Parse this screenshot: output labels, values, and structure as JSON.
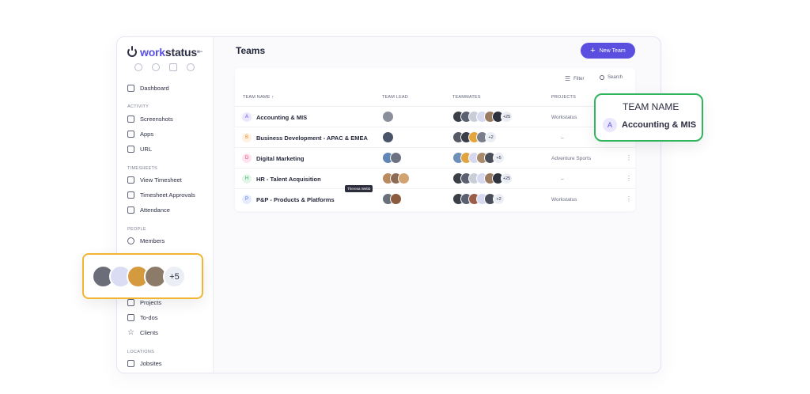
{
  "brand": {
    "logo_part1": "work",
    "logo_part2": "status"
  },
  "sidebar": {
    "items": [
      {
        "label": "Dashboard"
      },
      {
        "label": "Screenshots"
      },
      {
        "label": "Apps"
      },
      {
        "label": "URL"
      },
      {
        "label": "View Timesheet"
      },
      {
        "label": "Timesheet Approvals"
      },
      {
        "label": "Attendance"
      },
      {
        "label": "Members"
      },
      {
        "label": "Projects"
      },
      {
        "label": "To-dos"
      },
      {
        "label": "Clients"
      },
      {
        "label": "Jobsites"
      }
    ],
    "sections": [
      "ACTIVITY",
      "TIMESHEETS",
      "PEOPLE",
      "LOCATIONS"
    ]
  },
  "header": {
    "title": "Teams",
    "new_team_label": "New Team",
    "new_team_icon": "+"
  },
  "toolbar": {
    "filter_label": "Filter",
    "search_label": "Search"
  },
  "table": {
    "columns": [
      "TEAM NAME ↑",
      "TEAM LEAD",
      "TEAMMATES",
      "PROJECTS"
    ],
    "rows": [
      {
        "badge": "A",
        "name": "Accounting & MIS",
        "more": "+25",
        "project": "Workstatus"
      },
      {
        "badge": "B",
        "name": "Business Development - APAC & EMEA",
        "more": "+2",
        "project": "–"
      },
      {
        "badge": "D",
        "name": "Digital Marketing",
        "more": "+5",
        "project": "Adventure Sports"
      },
      {
        "badge": "H",
        "name": "HR - Talent Acquisition",
        "more": "+25",
        "project": "–"
      },
      {
        "badge": "P",
        "name": "P&P - Products & Platforms",
        "more": "+2",
        "project": "Workstatus"
      }
    ]
  },
  "tooltip": "Theresa Webb",
  "callout_team": {
    "title": "TEAM NAME",
    "badge": "A",
    "name": "Accounting & MIS"
  },
  "callout_avatars": {
    "more": "+5"
  },
  "colors": {
    "accent": "#5b4fe0",
    "green_callout": "#32b45f",
    "yellow_callout": "#f2b531"
  },
  "icons": [
    "collapse-icon",
    "search-icon",
    "filter-icon",
    "kebab-icon",
    "plus-icon"
  ]
}
